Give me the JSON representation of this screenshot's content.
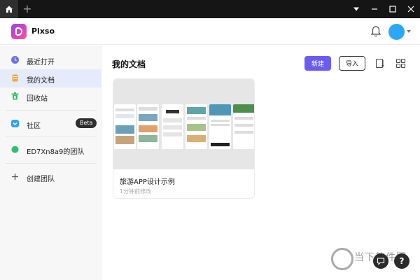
{
  "window": {
    "new_tab_symbol": "+"
  },
  "header": {
    "app_name": "Pixso"
  },
  "sidebar": {
    "items": [
      {
        "label": "最近打开",
        "icon": "clock-icon"
      },
      {
        "label": "我的文档",
        "icon": "document-icon"
      },
      {
        "label": "回收站",
        "icon": "trash-icon"
      },
      {
        "label": "社区",
        "icon": "community-icon",
        "badge": "Beta"
      },
      {
        "label": "ED7Xn8a9的团队",
        "icon": "team-dot-icon"
      },
      {
        "label": "创建团队",
        "icon": "plus-icon"
      }
    ]
  },
  "main": {
    "title": "我的文档",
    "new_button": "新建",
    "import_button": "导入",
    "file": {
      "name": "旅游APP设计示例",
      "modified": "1分钟前修改"
    }
  },
  "watermark": {
    "text": "当下软件园"
  },
  "fabs": {
    "help": "?"
  },
  "colors": {
    "accent": "#6a5cf2",
    "avatar": "#2ba8f5",
    "active_item_bg": "#e5ebfb",
    "titlebar": "#151515"
  }
}
